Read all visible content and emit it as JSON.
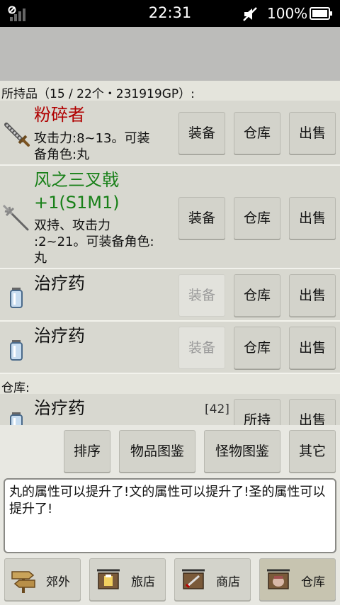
{
  "status_bar": {
    "time": "22:31",
    "battery": "100%"
  },
  "inventory": {
    "header": "所持品（15 / 22个・231919GP）:",
    "items": [
      {
        "name": "粉碎者",
        "desc_lines": [
          "攻击力:8~13。可装",
          "备角色:丸"
        ],
        "icon": "sword-icon",
        "name_color": "#b00000"
      },
      {
        "name_lines": [
          "风之三叉戟",
          "+1(S1M1)"
        ],
        "desc_lines": [
          "双持、攻击力",
          ":2~21。可装备角色:",
          "丸"
        ],
        "icon": "trident-icon",
        "name_color": "#188018"
      },
      {
        "name": "治疗药",
        "icon": "potion-icon"
      },
      {
        "name": "治疗药",
        "icon": "potion-icon"
      }
    ],
    "buttons": {
      "equip": "装备",
      "storage": "仓库",
      "sell": "出售"
    }
  },
  "warehouse": {
    "header": "仓库:",
    "items": [
      {
        "name": "治疗药",
        "count": "[42]",
        "icon": "potion-icon"
      }
    ],
    "buttons": {
      "hold": "所持",
      "sell": "出售"
    }
  },
  "toolbar": {
    "sort": "排序",
    "item_guide": "物品图鉴",
    "monster_guide": "怪物图鉴",
    "other": "其它"
  },
  "message": "丸的属性可以提升了!文的属性可以提升了!圣的属性可以提升了!",
  "nav": [
    {
      "label": "郊外",
      "icon": "signpost-icon"
    },
    {
      "label": "旅店",
      "icon": "inn-icon"
    },
    {
      "label": "商店",
      "icon": "shop-icon"
    },
    {
      "label": "仓库",
      "icon": "warehouse-icon",
      "active": true
    }
  ]
}
